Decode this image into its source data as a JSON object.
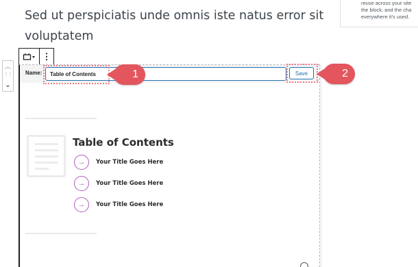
{
  "editor": {
    "heading_text": "Sed ut perspiciatis unde omnis iste natus error sit voluptatem"
  },
  "sidebar": {
    "lines": [
      "reuse across your site",
      "the block, and the cha",
      "everywhere it's used."
    ]
  },
  "block_mover": {
    "up_icon": "chevron-up-icon",
    "drag_icon": "drag-handle-icon",
    "down_icon": "chevron-down-icon"
  },
  "block_toolbar": {
    "block_type_icon": "reusable-block-icon",
    "dropdown_glyph": "▾",
    "more_glyph": "⋮"
  },
  "reusable_block": {
    "name_label": "Name:",
    "name_value": "Table of Contents",
    "save_label": "Save"
  },
  "callouts": {
    "first": "1",
    "second": "2",
    "highlight_color": "#ef7b8f",
    "badge_color": "#e3565e"
  },
  "toc": {
    "title": "Table of Contents",
    "items": [
      "Your Title Goes Here",
      "Your Title Goes Here",
      "Your Title Goes Here"
    ],
    "arrow_glyph": "→",
    "accent_color": "#b25cc0"
  }
}
